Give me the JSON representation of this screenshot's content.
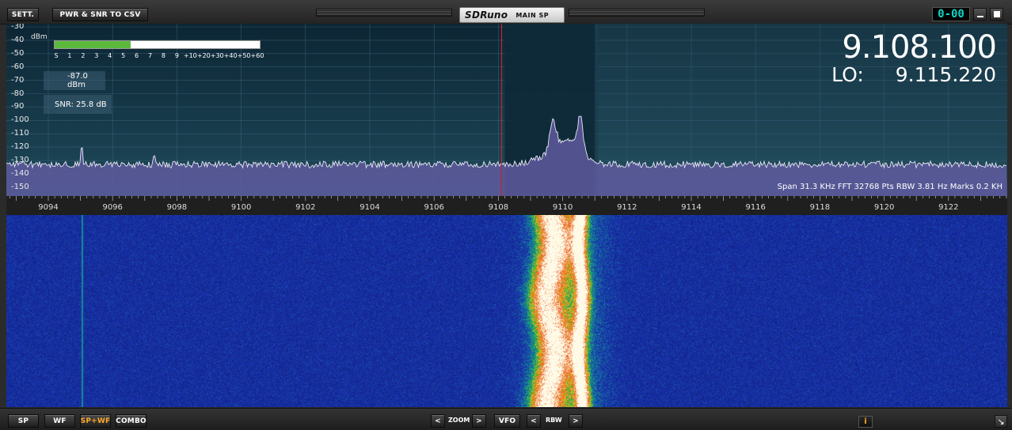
{
  "toolbar": {
    "settings_label": "SETT.",
    "export_label": "PWR & SNR TO CSV",
    "brand": "SDRuno",
    "mode": "MAIN SP",
    "clock": "0-00",
    "minimize_icon": "minimize-icon",
    "close_icon": "close-icon"
  },
  "spectrum": {
    "unit": "dBm",
    "y_labels": [
      "-30",
      "-40",
      "-50",
      "-60",
      "-70",
      "-80",
      "-90",
      "-100",
      "-110",
      "-120",
      "-130",
      "-140",
      "-150"
    ],
    "smeter_ticks": [
      "S",
      "1",
      "2",
      "3",
      "4",
      "5",
      "6",
      "7",
      "8",
      "9",
      "+10",
      "+20",
      "+30",
      "+40",
      "+50",
      "+60"
    ],
    "smeter_level_fraction": 0.37,
    "power_readout": "-87.0 dBm",
    "snr_readout": "SNR: 25.8 dB",
    "vfo_frequency": "9.108.100",
    "lo_label": "LO:",
    "lo_frequency": "9.115.220",
    "info": "Span 31.3 KHz   FFT 32768 Pts   RBW 3.81 Hz   Marks 0.2 KH"
  },
  "freq_axis": {
    "labels": [
      "9094",
      "9096",
      "9098",
      "9100",
      "9102",
      "9104",
      "9106",
      "9108",
      "9110",
      "9112",
      "9114",
      "9116",
      "9118",
      "9120",
      "9122"
    ]
  },
  "bottom": {
    "sp": "SP",
    "wf": "WF",
    "spwf": "SP+WF",
    "combo": "COMBO",
    "zoom": "ZOOM",
    "vfo": "VFO",
    "rbw": "RBW",
    "prev": "<",
    "next": ">",
    "info": "i",
    "resize_icon": "resize-icon"
  },
  "colors": {
    "accent": "#ffa92a",
    "smeter": "#5cb93d",
    "clock": "#0dd6c8",
    "vfo_line": "#c8232a"
  }
}
